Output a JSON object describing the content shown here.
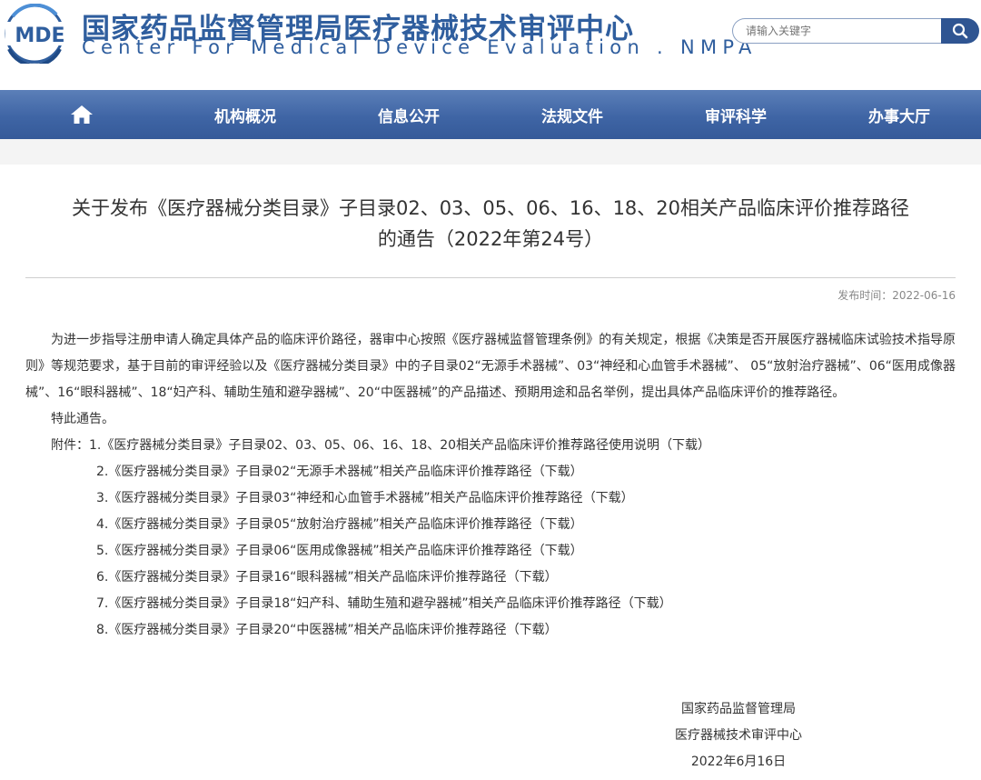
{
  "header": {
    "logo_text": "MDE",
    "title_cn": "国家药品监督管理局医疗器械技术审评中心",
    "title_en": "Center For Medical Device Evaluation . NMPA",
    "search_placeholder": "请输入关键字",
    "colors": {
      "brand": "#2f5e9e",
      "nav": "#3f65a5"
    }
  },
  "nav": {
    "home_icon": "home-icon",
    "items": [
      "机构概况",
      "信息公开",
      "法规文件",
      "审评科学",
      "办事大厅"
    ]
  },
  "article": {
    "title_line1": "关于发布《医疗器械分类目录》子目录02、03、05、06、16、18、20相关产品临床评价推荐路径",
    "title_line2": "的通告（2022年第24号）",
    "pub_label": "发布时间：",
    "pub_date": "2022-06-16",
    "body": "为进一步指导注册申请人确定具体产品的临床评价路径，器审中心按照《医疗器械监督管理条例》的有关规定，根据《决策是否开展医疗器械临床试验技术指导原则》等规范要求，基于目前的审评经验以及《医疗器械分类目录》中的子目录02“无源手术器械”、03“神经和心血管手术器械”、 05“放射治疗器械”、06“医用成像器械”、16“眼科器械”、18“妇产科、辅助生殖和避孕器械”、20“中医器械”的产品描述、预期用途和品名举例，提出具体产品临床评价的推荐路径。",
    "notice": "特此通告。",
    "attachments_label": "附件：",
    "download_label": "（下载）",
    "attachments": [
      "1.《医疗器械分类目录》子目录02、03、05、06、16、18、20相关产品临床评价推荐路径使用说明",
      "2.《医疗器械分类目录》子目录02“无源手术器械”相关产品临床评价推荐路径",
      "3.《医疗器械分类目录》子目录03“神经和心血管手术器械”相关产品临床评价推荐路径",
      "4.《医疗器械分类目录》子目录05“放射治疗器械”相关产品临床评价推荐路径",
      "5.《医疗器械分类目录》子目录06“医用成像器械”相关产品临床评价推荐路径",
      "6.《医疗器械分类目录》子目录16“眼科器械”相关产品临床评价推荐路径",
      "7.《医疗器械分类目录》子目录18“妇产科、辅助生殖和避孕器械”相关产品临床评价推荐路径",
      "8.《医疗器械分类目录》子目录20“中医器械”相关产品临床评价推荐路径"
    ],
    "signature": {
      "org1": "国家药品监督管理局",
      "org2": "医疗器械技术审评中心",
      "date": "2022年6月16日"
    }
  }
}
